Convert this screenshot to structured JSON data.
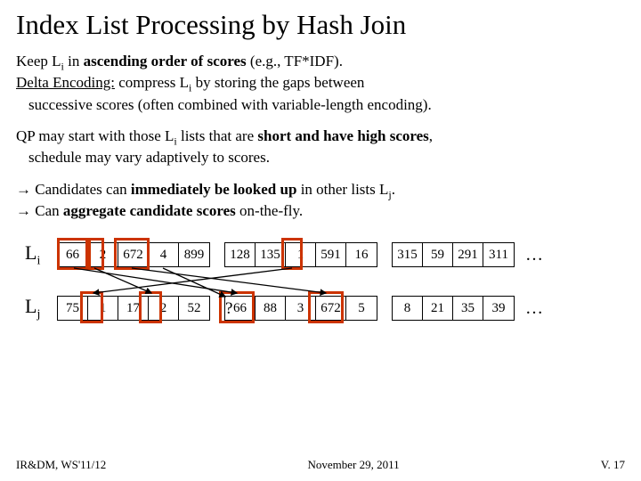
{
  "title": "Index List Processing by Hash Join",
  "para1_a": "Keep L",
  "para1_b": " in ",
  "para1_c": "ascending order of scores",
  "para1_d": " (e.g., TF*IDF).",
  "para2_a": "Delta Encoding:",
  "para2_b": " compress L",
  "para2_c": " by storing the gaps between",
  "para2_d": "successive scores (often combined with variable-length encoding).",
  "para3_a": "QP may start with those L",
  "para3_b": " lists that are ",
  "para3_c": "short and have high scores",
  "para3_d": ",",
  "para3_e": "schedule may vary adaptively to scores.",
  "arrow1_a": "→ Candidates can ",
  "arrow1_b": "immediately be looked up",
  "arrow1_c": " in other lists L",
  "arrow1_d": ".",
  "arrow2_a": "→ Can ",
  "arrow2_b": "aggregate candidate scores",
  "arrow2_c": " on-the-fly.",
  "li_label": "L",
  "li_sub": "i",
  "lj_label": "L",
  "lj_sub": "j",
  "li": {
    "g1": [
      "66",
      "2",
      "672",
      "4",
      "899"
    ],
    "g2": [
      "128",
      "135",
      "1",
      "591",
      "16"
    ],
    "g3": [
      "315",
      "59",
      "291",
      "311"
    ]
  },
  "lj": {
    "g1": [
      "75",
      "1",
      "17",
      "2",
      "52"
    ],
    "g2": [
      "66",
      "88",
      "3",
      "672",
      "5"
    ],
    "g3": [
      "8",
      "21",
      "35",
      "39"
    ]
  },
  "dots": "…",
  "qmark": "?",
  "footer_left": "IR&DM, WS'11/12",
  "footer_center": "November 29, 2011",
  "footer_right": "V. 17"
}
